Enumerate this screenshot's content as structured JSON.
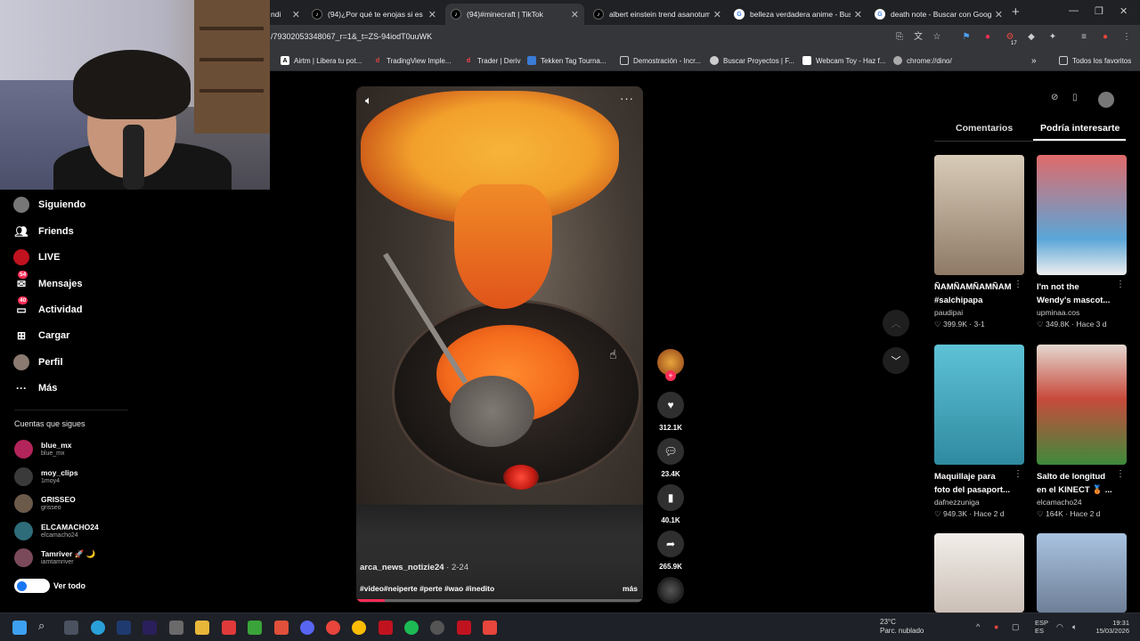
{
  "browser": {
    "tabs": [
      {
        "title": "ndi",
        "favicon": "tiktok-icon"
      },
      {
        "title": "(94)¿Por qué te enojas si es sol",
        "favicon": "tiktok-icon"
      },
      {
        "title": "(94)#minecraft | TikTok",
        "favicon": "tiktok-icon"
      },
      {
        "title": "albert einstein trend asanotum",
        "favicon": "tiktok-icon"
      },
      {
        "title": "belleza verdadera anime - Busc",
        "favicon": "google-icon"
      },
      {
        "title": "death note - Buscar con Googl",
        "favicon": "google-icon"
      }
    ],
    "url": "/79302053348067_r=1&_t=ZS-94iodT0uuWK",
    "bookmarks": [
      {
        "label": "Airtm | Libera tu pot...",
        "color": "#ffffff"
      },
      {
        "label": "TradingView Imple...",
        "color": "#e8453c"
      },
      {
        "label": "Trader | Deriv",
        "color": "#ff444f"
      },
      {
        "label": "Tekken Tag Tourna...",
        "color": "#3a7bd5"
      },
      {
        "label": "Demostración - Incr...",
        "color": "#e6e6e6"
      },
      {
        "label": "Buscar Proyectos | F...",
        "color": "#cccccc"
      },
      {
        "label": "Webcam Toy - Haz f...",
        "color": "#d4af37"
      },
      {
        "label": "chrome://dino/",
        "color": "#aaaaaa"
      }
    ],
    "bookmarks_all": "Todos los favoritos",
    "extension_badge": "17"
  },
  "sidebar": {
    "nav": [
      {
        "label": "Siguiendo",
        "icon": "following-avatar-icon"
      },
      {
        "label": "Friends",
        "icon": "friends-icon"
      },
      {
        "label": "LIVE",
        "icon": "live-icon"
      },
      {
        "label": "Mensajes",
        "icon": "messages-icon",
        "badge": "54"
      },
      {
        "label": "Actividad",
        "icon": "activity-icon",
        "badge": "40"
      },
      {
        "label": "Cargar",
        "icon": "upload-icon"
      },
      {
        "label": "Perfil",
        "icon": "profile-avatar-icon"
      },
      {
        "label": "Más",
        "icon": "more-icon"
      }
    ],
    "following_title": "Cuentas que sigues",
    "accounts": [
      {
        "name": "blue_mx",
        "handle": "blue_mx",
        "color": "#b3245a"
      },
      {
        "name": "moy_clips",
        "handle": "1moy4",
        "color": "#3a3a3a"
      },
      {
        "name": "GRISSEO",
        "handle": "grisseo",
        "color": "#6b5a4a"
      },
      {
        "name": "ELCAMACHO24",
        "handle": "elcamacho24",
        "color": "#2e6c7a"
      },
      {
        "name": "Tamriver 🚀 🌙",
        "handle": "iamtamriver",
        "color": "#7a4a5a"
      }
    ],
    "see_all": "Ver todo"
  },
  "video": {
    "author": "arca_news_notizie24",
    "date": "· 2-24",
    "tags": "#video#neiperte #perte #wao #inedito",
    "more": "más",
    "progress": 0.1
  },
  "actions": [
    {
      "icon": "heart-icon",
      "count": "312.1K"
    },
    {
      "icon": "comment-icon",
      "count": "23.4K"
    },
    {
      "icon": "bookmark-icon",
      "count": "40.1K"
    },
    {
      "icon": "share-icon",
      "count": "265.9K"
    }
  ],
  "right_panel": {
    "tabs": [
      "Comentarios",
      "Podría interesarte"
    ],
    "cards": [
      {
        "title": "ÑAMÑAMÑAMÑAM",
        "title2": "#salchipapa",
        "user": "paudipai",
        "stats": "♡ 399.9K · 3-1",
        "color": "#b9a48e"
      },
      {
        "title": "I'm not the",
        "title2": "Wendy's mascot...",
        "user": "upminaa.cos",
        "stats": "♡ 349.8K · Hace 3 d",
        "color": "#d65a5a"
      },
      {
        "title": "Maquillaje para",
        "title2": "foto del pasaport...",
        "user": "dafnezzuniga",
        "stats": "♡ 949.3K · Hace 2 d",
        "color": "#3fa3b5"
      },
      {
        "title": "Salto de longitud",
        "title2": "en el KINECT 🥉 ...",
        "user": "elcamacho24",
        "stats": "♡ 164K · Hace 2 d",
        "color": "#b9433c"
      },
      {
        "title": "",
        "title2": "",
        "user": "",
        "stats": "",
        "color": "#d9d2cc"
      },
      {
        "title": "",
        "title2": "",
        "user": "",
        "stats": "",
        "color": "#8fa7c4"
      }
    ]
  },
  "taskbar": {
    "weather_temp": "23°C",
    "weather_desc": "Parc. nublado",
    "lang1": "ESP",
    "lang2": "ES",
    "time": "19:31",
    "date": "15/03/2026"
  }
}
